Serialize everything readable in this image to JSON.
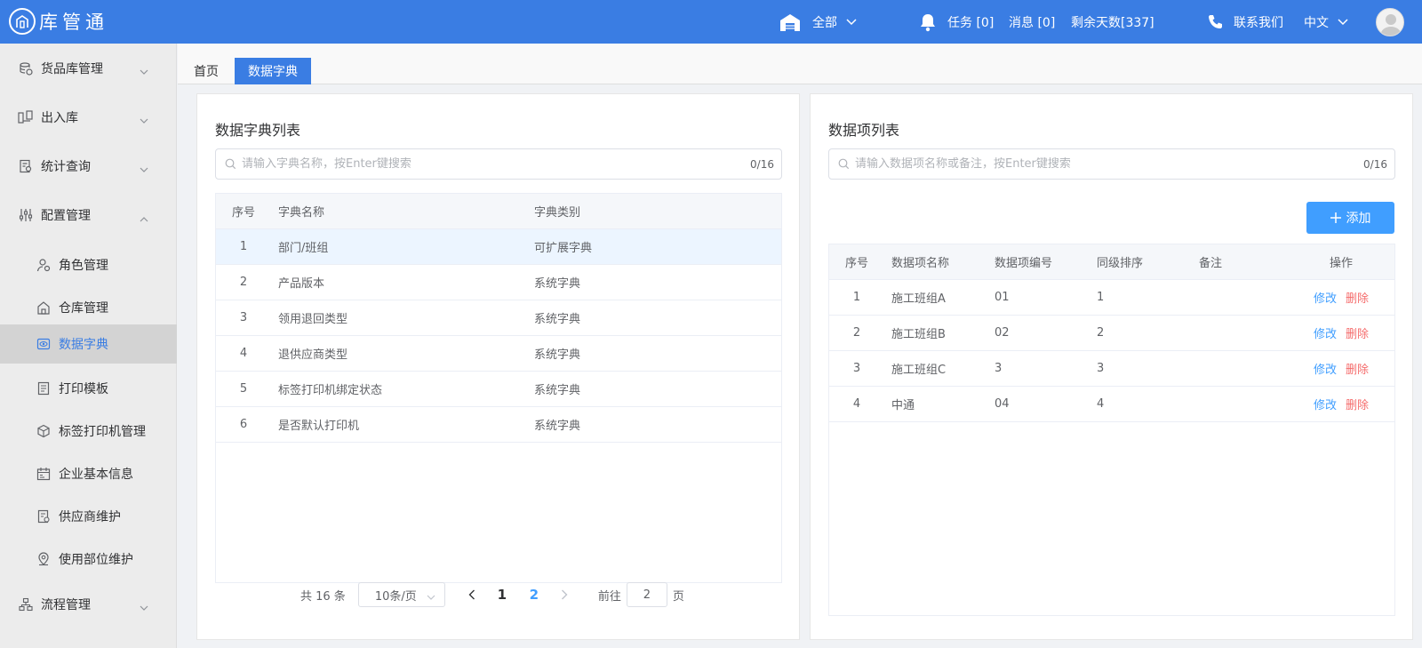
{
  "colors": {
    "header": "#3a7de3",
    "primary": "#409eff",
    "danger": "#f56c6c",
    "active_bg": "#d3d3d3"
  },
  "header": {
    "logo_text": "库管通",
    "warehouse_scope": "全部",
    "task_label": "任务 [0]",
    "message_label": "消息 [0]",
    "days_left": "剩余天数[337]",
    "contact_label": "联系我们",
    "language": "中文"
  },
  "sidebar": {
    "items": [
      {
        "label": "货品库管理",
        "icon": "database-icon"
      },
      {
        "label": "出入库",
        "icon": "transfer-icon"
      },
      {
        "label": "统计查询",
        "icon": "report-icon"
      },
      {
        "label": "配置管理",
        "icon": "sliders-icon"
      },
      {
        "label": "角色管理",
        "icon": "user-roles-icon"
      },
      {
        "label": "仓库管理",
        "icon": "warehouse-icon"
      },
      {
        "label": "数据字典",
        "icon": "dictionary-icon"
      },
      {
        "label": "打印模板",
        "icon": "template-icon"
      },
      {
        "label": "标签打印机管理",
        "icon": "cube-icon"
      },
      {
        "label": "企业基本信息",
        "icon": "calendar-icon"
      },
      {
        "label": "供应商维护",
        "icon": "supplier-icon"
      },
      {
        "label": "使用部位维护",
        "icon": "location-icon"
      },
      {
        "label": "流程管理",
        "icon": "flow-icon"
      }
    ]
  },
  "tabs": {
    "home": "首页",
    "current": "数据字典"
  },
  "dict_panel": {
    "title": "数据字典列表",
    "search_placeholder": "请输入字典名称，按Enter键搜索",
    "search_count": "0/16",
    "columns": [
      "序号",
      "字典名称",
      "字典类别"
    ],
    "rows": [
      [
        "1",
        "部门/班组",
        "可扩展字典"
      ],
      [
        "2",
        "产品版本",
        "系统字典"
      ],
      [
        "3",
        "领用退回类型",
        "系统字典"
      ],
      [
        "4",
        "退供应商类型",
        "系统字典"
      ],
      [
        "5",
        "标签打印机绑定状态",
        "系统字典"
      ],
      [
        "6",
        "是否默认打印机",
        "系统字典"
      ]
    ],
    "pagination": {
      "total": "共 16 条",
      "page_size": "10条/页",
      "pages": [
        "1",
        "2"
      ],
      "current_page": "2",
      "goto_label": "前往",
      "goto_value": "2",
      "page_suffix": "页"
    }
  },
  "item_panel": {
    "title": "数据项列表",
    "search_placeholder": "请输入数据项名称或备注，按Enter键搜索",
    "search_count": "0/16",
    "add_label": "添加",
    "columns": [
      "序号",
      "数据项名称",
      "数据项编号",
      "同级排序",
      "备注",
      "操作"
    ],
    "edit_label": "修改",
    "delete_label": "删除",
    "rows": [
      [
        "1",
        "施工班组A",
        "01",
        "1",
        ""
      ],
      [
        "2",
        "施工班组B",
        "02",
        "2",
        ""
      ],
      [
        "3",
        "施工班组C",
        "3",
        "3",
        ""
      ],
      [
        "4",
        "中通",
        "04",
        "4",
        ""
      ]
    ]
  }
}
